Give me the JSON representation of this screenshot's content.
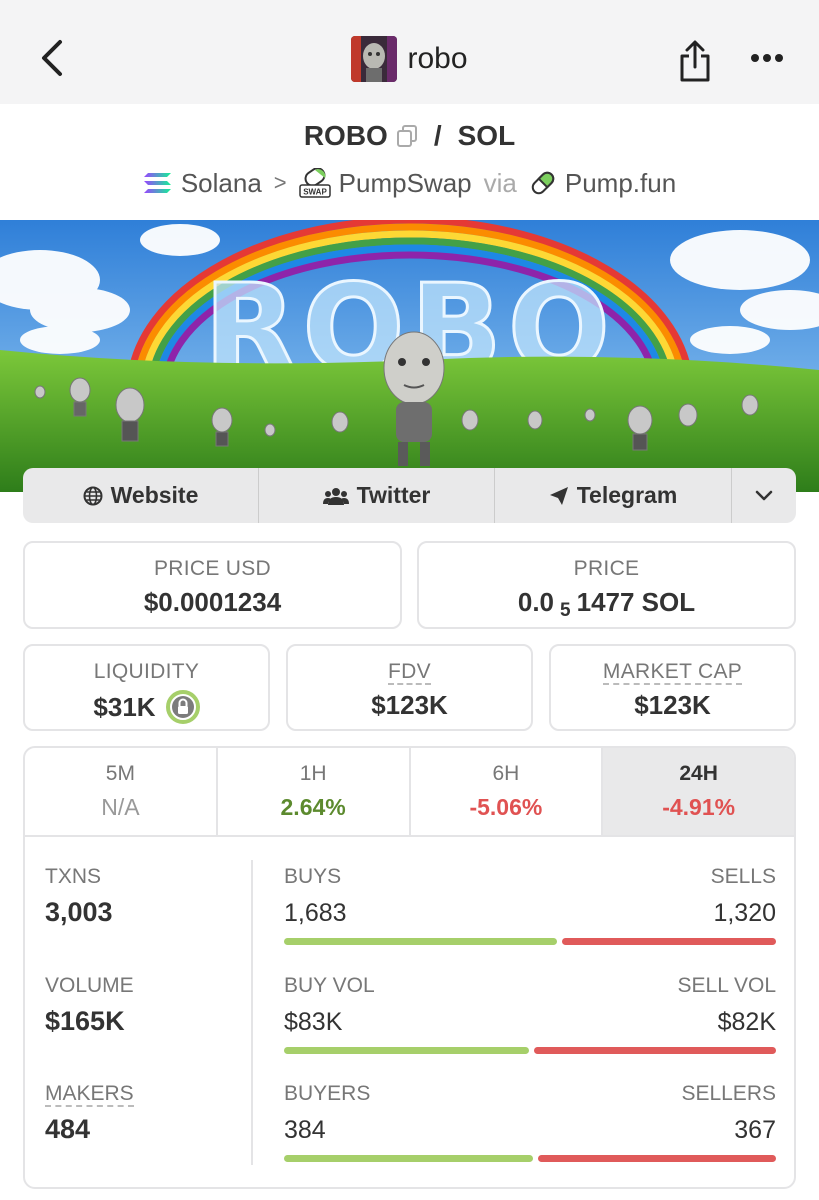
{
  "header": {
    "title": "robo"
  },
  "pair": {
    "base": "ROBO",
    "separator": "/",
    "quote": "SOL"
  },
  "breadcrumb": {
    "chain": "Solana",
    "dex": "PumpSwap",
    "via": "via",
    "launchpad": "Pump.fun",
    "dex_badge": "SWAP"
  },
  "banner": {
    "text": "ROBO"
  },
  "links": {
    "website": "Website",
    "twitter": "Twitter",
    "telegram": "Telegram"
  },
  "price_usd": {
    "label": "PRICE USD",
    "value": "$0.0001234"
  },
  "price_native": {
    "label": "PRICE",
    "prefix": "0.0",
    "sub": "5",
    "suffix": "1477 SOL"
  },
  "liquidity": {
    "label": "LIQUIDITY",
    "value": "$31K"
  },
  "fdv": {
    "label": "FDV",
    "value": "$123K"
  },
  "market_cap": {
    "label": "MARKET CAP",
    "value": "$123K"
  },
  "tabs": [
    {
      "label": "5M",
      "value": "N/A",
      "status": "na"
    },
    {
      "label": "1H",
      "value": "2.64%",
      "status": "pos"
    },
    {
      "label": "6H",
      "value": "-5.06%",
      "status": "neg"
    },
    {
      "label": "24H",
      "value": "-4.91%",
      "status": "neg",
      "active": true
    }
  ],
  "stats": {
    "txns": {
      "label": "TXNS",
      "value": "3,003"
    },
    "volume": {
      "label": "VOLUME",
      "value": "$165K"
    },
    "makers": {
      "label": "MAKERS",
      "value": "484"
    },
    "buys": {
      "label": "BUYS",
      "value": "1,683",
      "sell_label": "SELLS",
      "sell_value": "1,320",
      "buy_fraction": 0.56
    },
    "vol": {
      "label": "BUY VOL",
      "value": "$83K",
      "sell_label": "SELL VOL",
      "sell_value": "$82K",
      "buy_fraction": 0.503
    },
    "buyers": {
      "label": "BUYERS",
      "value": "384",
      "sell_label": "SELLERS",
      "sell_value": "367",
      "buy_fraction": 0.511
    }
  },
  "colors": {
    "positive": "#5c8a2e",
    "negative": "#e05252",
    "buy_bar": "#a6cf6a",
    "sell_bar": "#e05a5a"
  }
}
